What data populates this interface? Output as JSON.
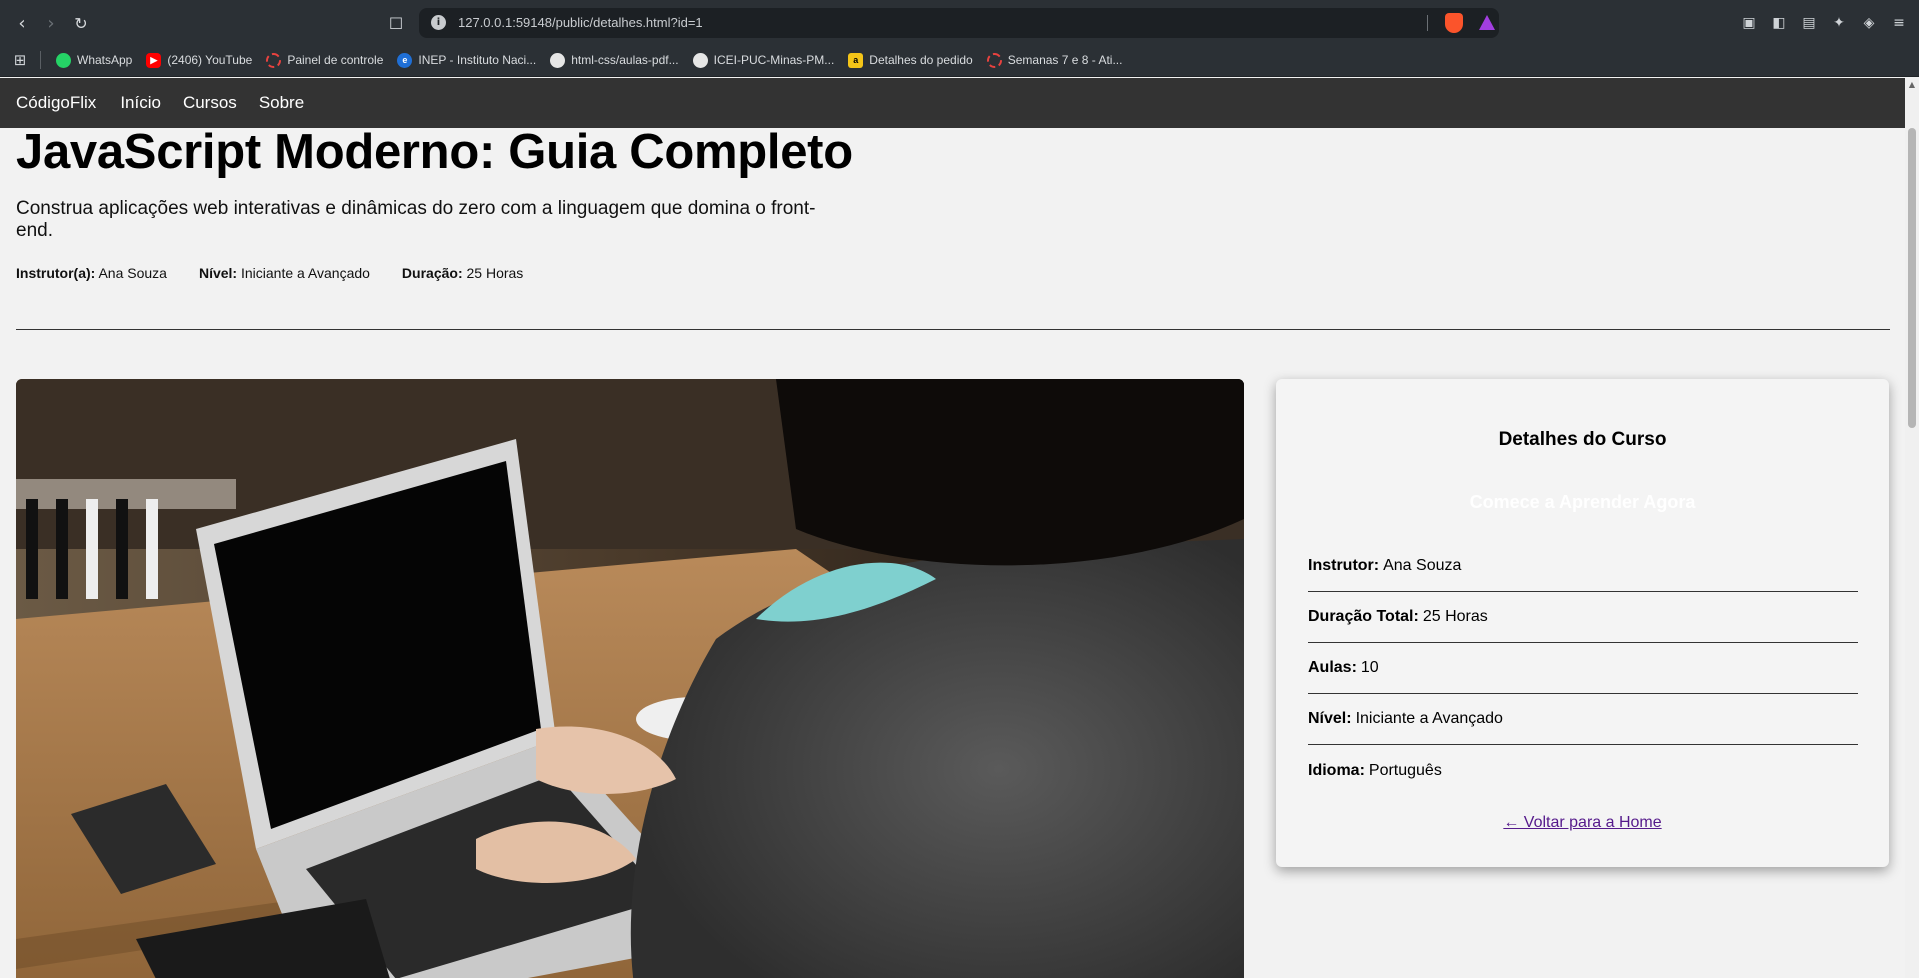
{
  "browser": {
    "url": "127.0.0.1:59148/public/detalhes.html?id=1",
    "bookmarks": [
      {
        "label": "WhatsApp",
        "color": "#25d366"
      },
      {
        "label": "(2406) YouTube",
        "color": "#ff0000"
      },
      {
        "label": "Painel de controle",
        "color": "#e8423f"
      },
      {
        "label": "INEP - Instituto Naci...",
        "color": "#1f6fd6"
      },
      {
        "label": "html-css/aulas-pdf...",
        "color": "#e6e6e6"
      },
      {
        "label": "ICEI-PUC-Minas-PM...",
        "color": "#e6e6e6"
      },
      {
        "label": "Detalhes do pedido",
        "color": "#f5c518"
      },
      {
        "label": "Semanas 7 e 8 - Ati...",
        "color": "#e8423f"
      }
    ]
  },
  "nav": {
    "logo": "CódigoFlix",
    "links": [
      "Início",
      "Cursos",
      "Sobre"
    ]
  },
  "hero": {
    "title": "JavaScript Moderno: Guia Completo",
    "subtitle": "Construa aplicações web interativas e dinâmicas do zero com a linguagem que domina o front-end.",
    "meta": {
      "instructor_label": "Instrutor(a):",
      "instructor": "Ana Souza",
      "level_label": "Nível:",
      "level": "Iniciante a Avançado",
      "duration_label": "Duração:",
      "duration": "25 Horas"
    }
  },
  "card": {
    "title": "Detalhes do Curso",
    "cta": "Comece a Aprender Agora",
    "rows": [
      {
        "label": "Instrutor:",
        "value": "Ana Souza"
      },
      {
        "label": "Duração Total:",
        "value": "25 Horas"
      },
      {
        "label": "Aulas:",
        "value": "10"
      },
      {
        "label": "Nível:",
        "value": "Iniciante a Avançado"
      },
      {
        "label": "Idioma:",
        "value": "Português"
      }
    ],
    "back_link": "← Voltar para a Home"
  }
}
